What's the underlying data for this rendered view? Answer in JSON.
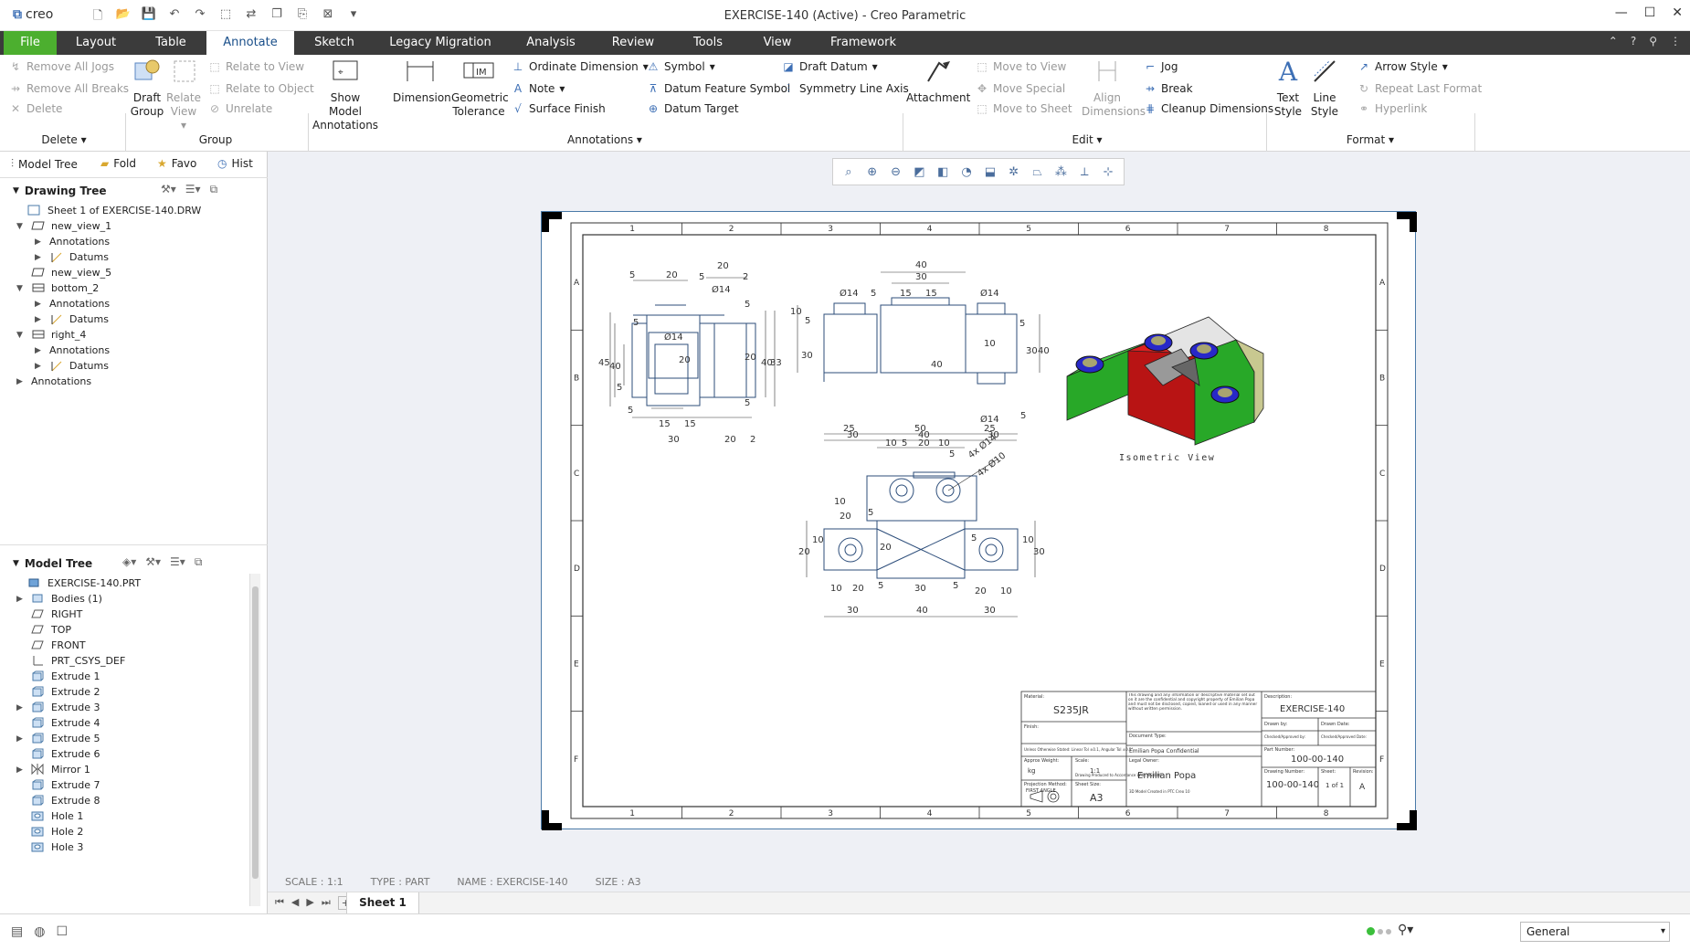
{
  "app": {
    "logo": "creo",
    "window_title": "EXERCISE-140 (Active) - Creo Parametric"
  },
  "tabs": [
    "File",
    "Layout",
    "Table",
    "Annotate",
    "Sketch",
    "Legacy Migration",
    "Analysis",
    "Review",
    "Tools",
    "View",
    "Framework"
  ],
  "ribbon": {
    "delete_group": {
      "items": [
        "Remove All Jogs",
        "Remove All Breaks",
        "Delete"
      ],
      "label": "Delete"
    },
    "group_group": {
      "draft_group": "Draft Group",
      "relate_view": "Relate View",
      "items": [
        "Relate to View",
        "Relate to Object",
        "Unrelate"
      ],
      "label": "Group"
    },
    "annotations_group": {
      "show_model": "Show Model Annotations",
      "dimension": "Dimension",
      "geometric_tolerance": "Geometric Tolerance",
      "items": [
        "Ordinate Dimension",
        "Note",
        "Surface Finish",
        "Symbol",
        "Datum Feature Symbol",
        "Datum Target",
        "Draft Datum",
        "Symmetry Line Axis"
      ],
      "label": "Annotations"
    },
    "edit_group": {
      "attachment": "Attachment",
      "items": [
        "Move to View",
        "Move Special",
        "Move to Sheet"
      ],
      "align": "Align Dimensions",
      "items2": [
        "Jog",
        "Break",
        "Cleanup Dimensions"
      ],
      "label": "Edit"
    },
    "format_group": {
      "text_style": "Text Style",
      "line_style": "Line Style",
      "items": [
        "Arrow Style",
        "Repeat Last Format",
        "Hyperlink"
      ],
      "label": "Format"
    }
  },
  "left_panel": {
    "tabs": [
      "Model Tree",
      "Fold",
      "Favo",
      "Hist"
    ],
    "drawing_tree": {
      "header": "Drawing Tree",
      "items": [
        "Sheet 1 of EXERCISE-140.DRW",
        "new_view_1",
        "Annotations",
        "Datums",
        "new_view_5",
        "bottom_2",
        "Annotations",
        "Datums",
        "right_4",
        "Annotations",
        "Datums",
        "Annotations"
      ]
    },
    "model_tree": {
      "header": "Model Tree",
      "items": [
        "EXERCISE-140.PRT",
        "Bodies (1)",
        "RIGHT",
        "TOP",
        "FRONT",
        "PRT_CSYS_DEF",
        "Extrude 1",
        "Extrude 2",
        "Extrude 3",
        "Extrude 4",
        "Extrude 5",
        "Extrude 6",
        "Mirror 1",
        "Extrude 7",
        "Extrude 8",
        "Hole 1",
        "Hole 2",
        "Hole 3"
      ]
    }
  },
  "drawing": {
    "col_labels": [
      "1",
      "2",
      "3",
      "4",
      "5",
      "6",
      "7",
      "8"
    ],
    "row_labels": [
      "A",
      "B",
      "C",
      "D",
      "E",
      "F"
    ],
    "iso_label": "Isometric View",
    "front_dims": [
      "5",
      "20",
      "20",
      "5",
      "Ø14",
      "2",
      "45",
      "40",
      "Ø14",
      "20",
      "5",
      "5",
      "40",
      "33",
      "20",
      "5",
      "5",
      "5",
      "15",
      "15",
      "30",
      "20",
      "2"
    ],
    "top_dims": [
      "40",
      "30",
      "Ø14",
      "5",
      "15",
      "15",
      "Ø14",
      "10",
      "5",
      "30",
      "40",
      "10",
      "5",
      "30",
      "40",
      "Ø14",
      "5",
      "30",
      "40",
      "30"
    ],
    "bottom_dims": [
      "25",
      "50",
      "25",
      "10",
      "5",
      "20",
      "10",
      "5",
      "4x Ø14",
      "4x Ø10",
      "10",
      "20",
      "20",
      "10",
      "10",
      "5",
      "20",
      "30",
      "5",
      "10",
      "20",
      "5",
      "30",
      "5",
      "20",
      "10",
      "30",
      "40",
      "30"
    ],
    "title_block": {
      "material_label": "Material:",
      "material": "S235JR",
      "finish_label": "Finish:",
      "conf_text": "This drawing and any information or descriptive material set out on it are the confidential and copyright property of Emilian Popa and must not be disclosed, copied, loaned or used in any manner without written permission.",
      "description_label": "Description:",
      "description": "EXERCISE-140",
      "drawn_label": "Drawn by:",
      "drawn_date": "Drawn Date:",
      "checked_label": "Checked/Approved by:",
      "checked_date": "Checked/Approved Date:",
      "doc_type_label": "Document Type:",
      "doc_type": "Emilian Popa Confidential",
      "part_label": "Part Number:",
      "part_number": "100-00-140",
      "approx_weight_label": "Approx Weight:",
      "weight": "kg",
      "proj_label": "Projection Method:",
      "proj": "FIRST ANGLE",
      "scale_label": "Scale:",
      "scale": "1:1",
      "sheet_size_label": "Sheet Size:",
      "sheet_size": "A3",
      "legal_label": "Legal Owner:",
      "legal": "Emilian Popa",
      "drawing_number_label": "Drawing Number:",
      "drawing_number": "100-00-140",
      "sheet_label": "Sheet:",
      "sheet": "1 of 1",
      "revision_label": "Revision:",
      "revision": "A",
      "general_tol": "Unless Otherwise Stated: Linear Tol ±0.1, Angular Tol ±0.5°",
      "note1": "Drawing Produced to Accordance With: BS8888",
      "note2": "3D Model Created in PTC Creo 10"
    }
  },
  "status": {
    "scale": "SCALE : 1:1",
    "type": "TYPE : PART",
    "name": "NAME : EXERCISE-140",
    "size": "SIZE : A3"
  },
  "sheet_tab": "Sheet 1",
  "bottom": {
    "filter": "General"
  }
}
